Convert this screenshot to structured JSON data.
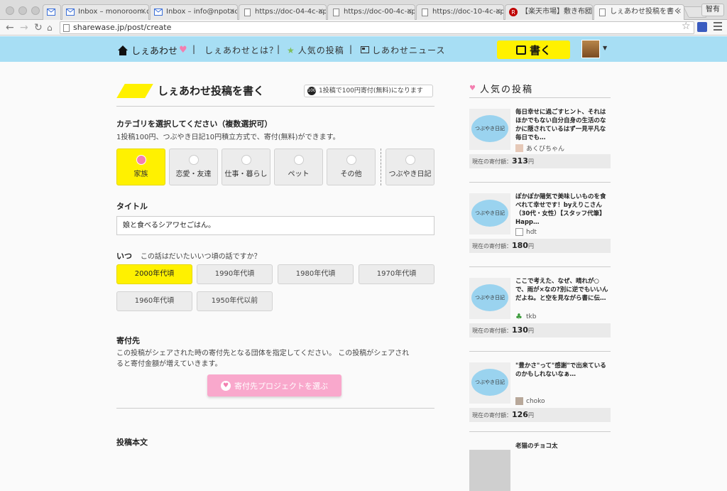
{
  "browser": {
    "tabs": [
      {
        "label": "",
        "icon": "mail-icon"
      },
      {
        "label": "Inbox – monoroom.dm",
        "icon": "mail-icon"
      },
      {
        "label": "Inbox – info@npotadai",
        "icon": "mail-icon"
      },
      {
        "label": "https://doc-04-4c-app",
        "icon": "doc-icon"
      },
      {
        "label": "https://doc-00-4c-app",
        "icon": "doc-icon"
      },
      {
        "label": "https://doc-10-4c-app",
        "icon": "doc-icon"
      },
      {
        "label": "【楽天市場】敷き布団用",
        "icon": "rakuten-icon"
      },
      {
        "label": "しぇあわせ投稿を書く | し",
        "icon": "doc-icon"
      }
    ],
    "profile": "智有",
    "url": "sharewase.jp/post/create"
  },
  "header": {
    "logo": "しぇあわせ",
    "nav": [
      "しぇあわせとは？",
      "人気の投稿",
      "しあわせニュース"
    ],
    "write": "書く"
  },
  "main": {
    "title": "しぇあわせ投稿を書く",
    "notice_badge": "100",
    "notice": "1投稿で100円寄付(無料)になります",
    "category_label": "カテゴリを選択してください（複数選択可）",
    "category_desc": "1投稿100円、つぶやき日記10円積立方式で、寄付(無料)ができます。",
    "categories": [
      "家族",
      "恋愛・友達",
      "仕事・暮らし",
      "ペット",
      "その他",
      "つぶやき日記"
    ],
    "title_label": "タイトル",
    "title_value": "娘と食べるシアワセごはん。",
    "when_label": "いつ",
    "when_question": "この話はだいたいいつ頃の話ですか？",
    "eras": [
      "2000年代頃",
      "1990年代頃",
      "1980年代頃",
      "1970年代頃",
      "1960年代頃",
      "1950年代以前"
    ],
    "donate_label": "寄付先",
    "donate_desc1": "この投稿がシェアされた時の寄付先となる団体を指定してください。 この投稿がシェアされ",
    "donate_desc2": "ると寄付金額が増えていきます。",
    "donate_button": "寄付先プロジェクトを選ぶ",
    "body_label": "投稿本文"
  },
  "sidebar": {
    "title": "人気の投稿",
    "thumb_label": "つぶやき日記",
    "current_label": "現在の寄付額：",
    "yen": "円",
    "cards": [
      {
        "title": "毎日幸せに過ごすヒント、それはほかでもない自分自身の生活のなかに隠されているはず一見平凡な毎日でも…",
        "author": "あくびちゃん",
        "amount": "313"
      },
      {
        "title": "ぽかぽか陽気で美味しいものを食べれて幸せです！byえりこさん（30代・女性）【スタッフ代筆】Happ…",
        "author": "hdt",
        "amount": "180"
      },
      {
        "title": "ここで考えた、なぜ、晴れが○で、雨が×なの?別に逆でもいいんだよね。と空を見ながら書に伝…",
        "author": "tkb",
        "amount": "130"
      },
      {
        "title": "\"豊かさ\"って\"感謝\"で出来ているのかもしれないなぁ…",
        "author": "choko",
        "amount": "126"
      },
      {
        "title": "老猫のチョコ太",
        "author": "",
        "amount": ""
      }
    ]
  }
}
